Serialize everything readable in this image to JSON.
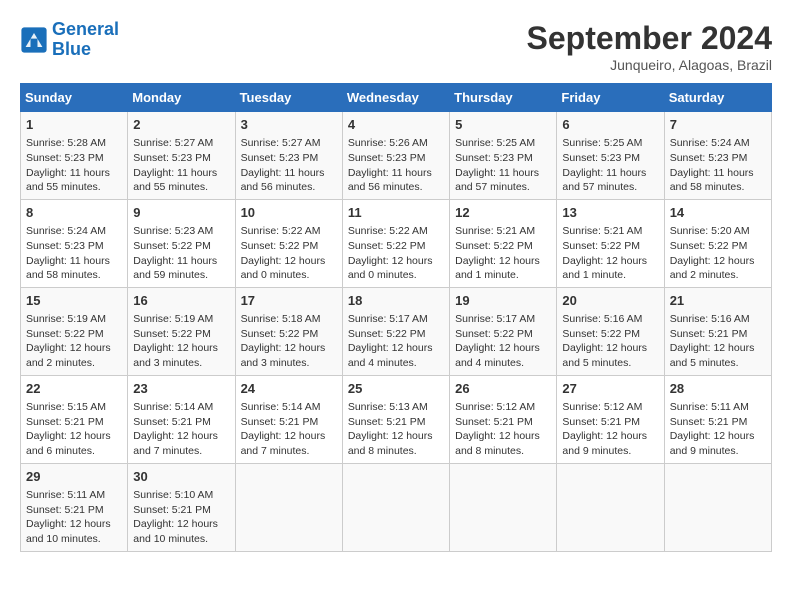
{
  "header": {
    "logo_line1": "General",
    "logo_line2": "Blue",
    "month": "September 2024",
    "location": "Junqueiro, Alagoas, Brazil"
  },
  "days_of_week": [
    "Sunday",
    "Monday",
    "Tuesday",
    "Wednesday",
    "Thursday",
    "Friday",
    "Saturday"
  ],
  "weeks": [
    [
      {
        "day": 1,
        "info": "Sunrise: 5:28 AM\nSunset: 5:23 PM\nDaylight: 11 hours\nand 55 minutes."
      },
      {
        "day": 2,
        "info": "Sunrise: 5:27 AM\nSunset: 5:23 PM\nDaylight: 11 hours\nand 55 minutes."
      },
      {
        "day": 3,
        "info": "Sunrise: 5:27 AM\nSunset: 5:23 PM\nDaylight: 11 hours\nand 56 minutes."
      },
      {
        "day": 4,
        "info": "Sunrise: 5:26 AM\nSunset: 5:23 PM\nDaylight: 11 hours\nand 56 minutes."
      },
      {
        "day": 5,
        "info": "Sunrise: 5:25 AM\nSunset: 5:23 PM\nDaylight: 11 hours\nand 57 minutes."
      },
      {
        "day": 6,
        "info": "Sunrise: 5:25 AM\nSunset: 5:23 PM\nDaylight: 11 hours\nand 57 minutes."
      },
      {
        "day": 7,
        "info": "Sunrise: 5:24 AM\nSunset: 5:23 PM\nDaylight: 11 hours\nand 58 minutes."
      }
    ],
    [
      {
        "day": 8,
        "info": "Sunrise: 5:24 AM\nSunset: 5:23 PM\nDaylight: 11 hours\nand 58 minutes."
      },
      {
        "day": 9,
        "info": "Sunrise: 5:23 AM\nSunset: 5:22 PM\nDaylight: 11 hours\nand 59 minutes."
      },
      {
        "day": 10,
        "info": "Sunrise: 5:22 AM\nSunset: 5:22 PM\nDaylight: 12 hours\nand 0 minutes."
      },
      {
        "day": 11,
        "info": "Sunrise: 5:22 AM\nSunset: 5:22 PM\nDaylight: 12 hours\nand 0 minutes."
      },
      {
        "day": 12,
        "info": "Sunrise: 5:21 AM\nSunset: 5:22 PM\nDaylight: 12 hours\nand 1 minute."
      },
      {
        "day": 13,
        "info": "Sunrise: 5:21 AM\nSunset: 5:22 PM\nDaylight: 12 hours\nand 1 minute."
      },
      {
        "day": 14,
        "info": "Sunrise: 5:20 AM\nSunset: 5:22 PM\nDaylight: 12 hours\nand 2 minutes."
      }
    ],
    [
      {
        "day": 15,
        "info": "Sunrise: 5:19 AM\nSunset: 5:22 PM\nDaylight: 12 hours\nand 2 minutes."
      },
      {
        "day": 16,
        "info": "Sunrise: 5:19 AM\nSunset: 5:22 PM\nDaylight: 12 hours\nand 3 minutes."
      },
      {
        "day": 17,
        "info": "Sunrise: 5:18 AM\nSunset: 5:22 PM\nDaylight: 12 hours\nand 3 minutes."
      },
      {
        "day": 18,
        "info": "Sunrise: 5:17 AM\nSunset: 5:22 PM\nDaylight: 12 hours\nand 4 minutes."
      },
      {
        "day": 19,
        "info": "Sunrise: 5:17 AM\nSunset: 5:22 PM\nDaylight: 12 hours\nand 4 minutes."
      },
      {
        "day": 20,
        "info": "Sunrise: 5:16 AM\nSunset: 5:22 PM\nDaylight: 12 hours\nand 5 minutes."
      },
      {
        "day": 21,
        "info": "Sunrise: 5:16 AM\nSunset: 5:21 PM\nDaylight: 12 hours\nand 5 minutes."
      }
    ],
    [
      {
        "day": 22,
        "info": "Sunrise: 5:15 AM\nSunset: 5:21 PM\nDaylight: 12 hours\nand 6 minutes."
      },
      {
        "day": 23,
        "info": "Sunrise: 5:14 AM\nSunset: 5:21 PM\nDaylight: 12 hours\nand 7 minutes."
      },
      {
        "day": 24,
        "info": "Sunrise: 5:14 AM\nSunset: 5:21 PM\nDaylight: 12 hours\nand 7 minutes."
      },
      {
        "day": 25,
        "info": "Sunrise: 5:13 AM\nSunset: 5:21 PM\nDaylight: 12 hours\nand 8 minutes."
      },
      {
        "day": 26,
        "info": "Sunrise: 5:12 AM\nSunset: 5:21 PM\nDaylight: 12 hours\nand 8 minutes."
      },
      {
        "day": 27,
        "info": "Sunrise: 5:12 AM\nSunset: 5:21 PM\nDaylight: 12 hours\nand 9 minutes."
      },
      {
        "day": 28,
        "info": "Sunrise: 5:11 AM\nSunset: 5:21 PM\nDaylight: 12 hours\nand 9 minutes."
      }
    ],
    [
      {
        "day": 29,
        "info": "Sunrise: 5:11 AM\nSunset: 5:21 PM\nDaylight: 12 hours\nand 10 minutes."
      },
      {
        "day": 30,
        "info": "Sunrise: 5:10 AM\nSunset: 5:21 PM\nDaylight: 12 hours\nand 10 minutes."
      },
      {
        "day": null,
        "info": ""
      },
      {
        "day": null,
        "info": ""
      },
      {
        "day": null,
        "info": ""
      },
      {
        "day": null,
        "info": ""
      },
      {
        "day": null,
        "info": ""
      }
    ]
  ]
}
